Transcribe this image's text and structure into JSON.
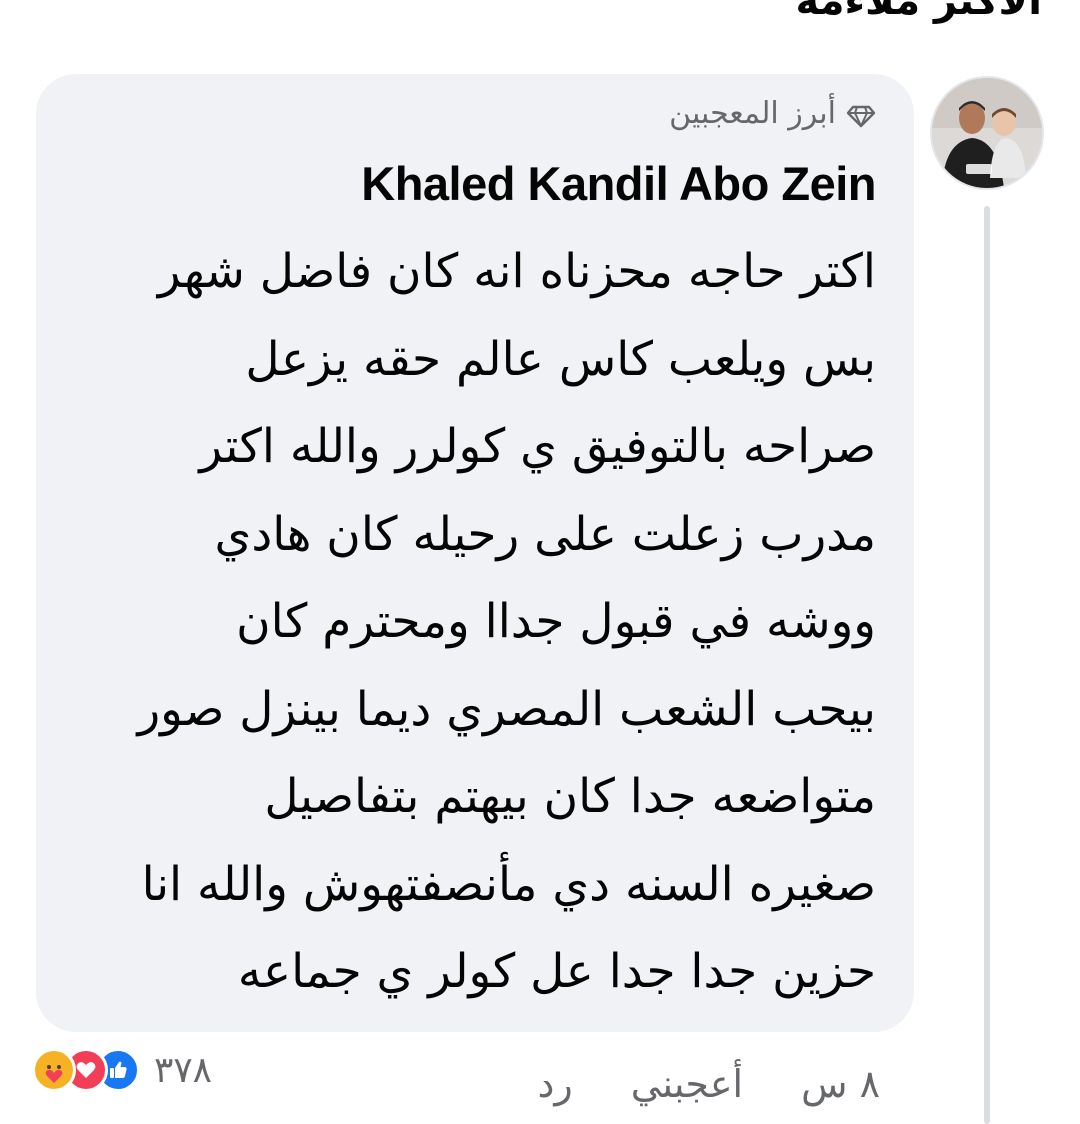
{
  "header_fragment": "الأكثر ملاءمة",
  "comment": {
    "badge": "أبرز المعجبين",
    "author": "Khaled Kandil Abo Zein",
    "lines": [
      "اكتر حاجه محزناه انه كان فاضل شهر",
      "بس ويلعب كاس عالم حقه يزعل",
      "صراحه بالتوفيق ي كولرر والله اكتر",
      "مدرب زعلت على رحيله كان هادي",
      "ووشه في قبول جداا ومحترم كان",
      "بيحب الشعب المصري ديما بينزل صور",
      "متواضعه جدا كان بيهتم بتفاصيل",
      "صغيره السنه دي مأنصفتهوش والله انا",
      "حزين جدا جدا عل كولر ي جماعه"
    ],
    "time": "٨ س",
    "like_label": "أعجبني",
    "reply_label": "رد",
    "reactions": {
      "count": "٣٧٨",
      "types": [
        "care-icon",
        "love-icon",
        "like-icon"
      ]
    }
  },
  "colors": {
    "bubble": "#f0f2f5",
    "secondary_text": "#65676b",
    "like_blue": "#1877f2",
    "love_red": "#f33e58",
    "care_yellow": "#f7b125"
  }
}
